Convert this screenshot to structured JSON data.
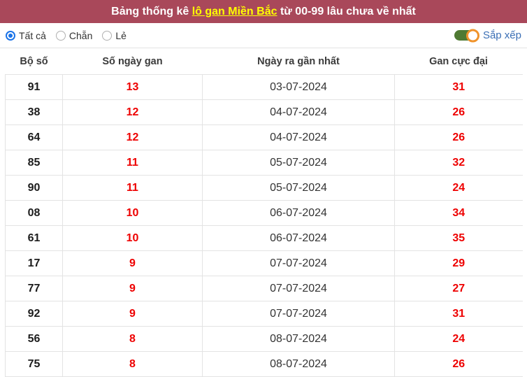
{
  "banner": {
    "title_prefix": "Bảng thống kê ",
    "title_keyword": "lô gan Miền Bắc",
    "title_suffix": " từ 00-99 lâu chưa về nhất"
  },
  "controls": {
    "filters": [
      {
        "label": "Tất cả",
        "selected": true
      },
      {
        "label": "Chẵn",
        "selected": false
      },
      {
        "label": "Lẻ",
        "selected": false
      }
    ],
    "sort_label": "Sắp xếp",
    "sort_on": true,
    "toggle_track_color": "#4f7a33",
    "toggle_knob_color": "#f0932b"
  },
  "theme": {
    "banner_bg": "#a9485a",
    "banner_text": "#ffffff",
    "banner_keyword": "#ffff00",
    "accent_red": "#ee0000",
    "radio_blue": "#1a73e8",
    "link_blue": "#3b6fb5",
    "grid_line": "#e3e3e3"
  },
  "table": {
    "headers": [
      "Bộ số",
      "Số ngày gan",
      "Ngày ra gần nhất",
      "Gan cực đại"
    ],
    "rows": [
      {
        "bo_so": "91",
        "so_ngay_gan": "13",
        "ngay_ra": "03-07-2024",
        "gan_cuc_dai": "31"
      },
      {
        "bo_so": "38",
        "so_ngay_gan": "12",
        "ngay_ra": "04-07-2024",
        "gan_cuc_dai": "26"
      },
      {
        "bo_so": "64",
        "so_ngay_gan": "12",
        "ngay_ra": "04-07-2024",
        "gan_cuc_dai": "26"
      },
      {
        "bo_so": "85",
        "so_ngay_gan": "11",
        "ngay_ra": "05-07-2024",
        "gan_cuc_dai": "32"
      },
      {
        "bo_so": "90",
        "so_ngay_gan": "11",
        "ngay_ra": "05-07-2024",
        "gan_cuc_dai": "24"
      },
      {
        "bo_so": "08",
        "so_ngay_gan": "10",
        "ngay_ra": "06-07-2024",
        "gan_cuc_dai": "34"
      },
      {
        "bo_so": "61",
        "so_ngay_gan": "10",
        "ngay_ra": "06-07-2024",
        "gan_cuc_dai": "35"
      },
      {
        "bo_so": "17",
        "so_ngay_gan": "9",
        "ngay_ra": "07-07-2024",
        "gan_cuc_dai": "29"
      },
      {
        "bo_so": "77",
        "so_ngay_gan": "9",
        "ngay_ra": "07-07-2024",
        "gan_cuc_dai": "27"
      },
      {
        "bo_so": "92",
        "so_ngay_gan": "9",
        "ngay_ra": "07-07-2024",
        "gan_cuc_dai": "31"
      },
      {
        "bo_so": "56",
        "so_ngay_gan": "8",
        "ngay_ra": "08-07-2024",
        "gan_cuc_dai": "24"
      },
      {
        "bo_so": "75",
        "so_ngay_gan": "8",
        "ngay_ra": "08-07-2024",
        "gan_cuc_dai": "26"
      }
    ]
  }
}
